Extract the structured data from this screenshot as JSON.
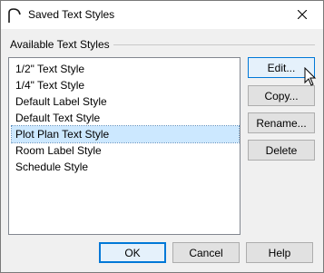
{
  "window": {
    "title": "Saved Text Styles",
    "app_icon": "dimension-arc-icon",
    "close_icon": "close-icon"
  },
  "group": {
    "label": "Available Text Styles"
  },
  "styles_list": {
    "items": [
      "1/2\" Text Style",
      "1/4\" Text Style",
      "Default Label Style",
      "Default Text Style",
      "Plot Plan Text Style",
      "Room Label Style",
      "Schedule Style"
    ],
    "selected": "Plot Plan Text Style"
  },
  "side_buttons": {
    "edit": "Edit...",
    "copy": "Copy...",
    "rename": "Rename...",
    "delete": "Delete"
  },
  "footer_buttons": {
    "ok": "OK",
    "cancel": "Cancel",
    "help": "Help"
  },
  "colors": {
    "selection": "#cce8ff",
    "accent": "#0078d7"
  }
}
